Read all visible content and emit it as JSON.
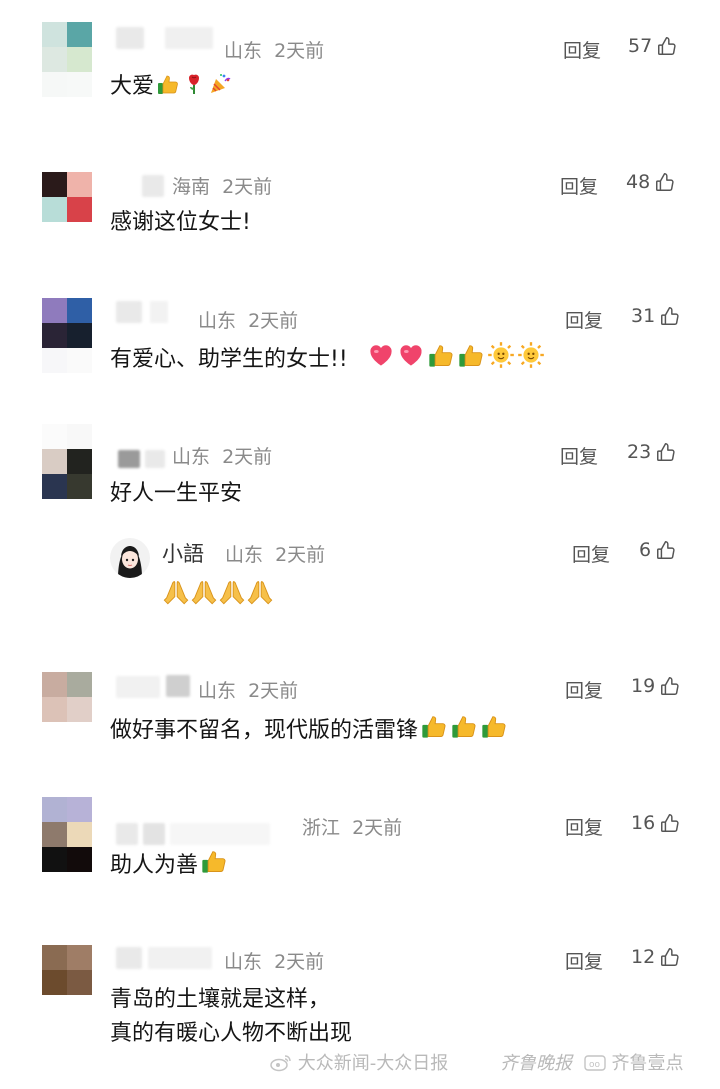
{
  "comments": [
    {
      "location": "山东",
      "time": "2天前",
      "reply": "回复",
      "likes": "57",
      "text": "大爱"
    },
    {
      "location": "海南",
      "time": "2天前",
      "reply": "回复",
      "likes": "48",
      "text": "感谢这位女士!"
    },
    {
      "location": "山东",
      "time": "2天前",
      "reply": "回复",
      "likes": "31",
      "text": "有爱心、助学生的女士!!"
    },
    {
      "location": "山东",
      "time": "2天前",
      "reply": "回复",
      "likes": "23",
      "text": "好人一生平安",
      "sub_reply": {
        "name": "小語",
        "location": "山东",
        "time": "2天前",
        "reply": "回复",
        "likes": "6"
      }
    },
    {
      "location": "山东",
      "time": "2天前",
      "reply": "回复",
      "likes": "19",
      "text": "做好事不留名，现代版的活雷锋"
    },
    {
      "location": "浙江",
      "time": "2天前",
      "reply": "回复",
      "likes": "16",
      "text": "助人为善"
    },
    {
      "location": "山东",
      "time": "2天前",
      "reply": "回复",
      "likes": "12",
      "text_line1": "青岛的土壤就是这样，",
      "text_line2": "真的有暖心人物不断出现"
    }
  ],
  "watermark": {
    "left": "大众新闻-大众日报",
    "right_logo": "齐鲁晚报",
    "right": "齐鲁壹点"
  },
  "colors": {
    "thumbs": "#f6b92b",
    "heart": "#f0446b",
    "sun": "#f7a823",
    "meta_text": "#8a8a8a"
  },
  "icons": [
    "thumbs-up-outline-icon",
    "thumbs-up-emoji",
    "rose-emoji",
    "party-popper-emoji",
    "heart-emoji",
    "sun-emoji",
    "pray-emoji",
    "weibo-logo-icon",
    "media-logo-icon"
  ]
}
